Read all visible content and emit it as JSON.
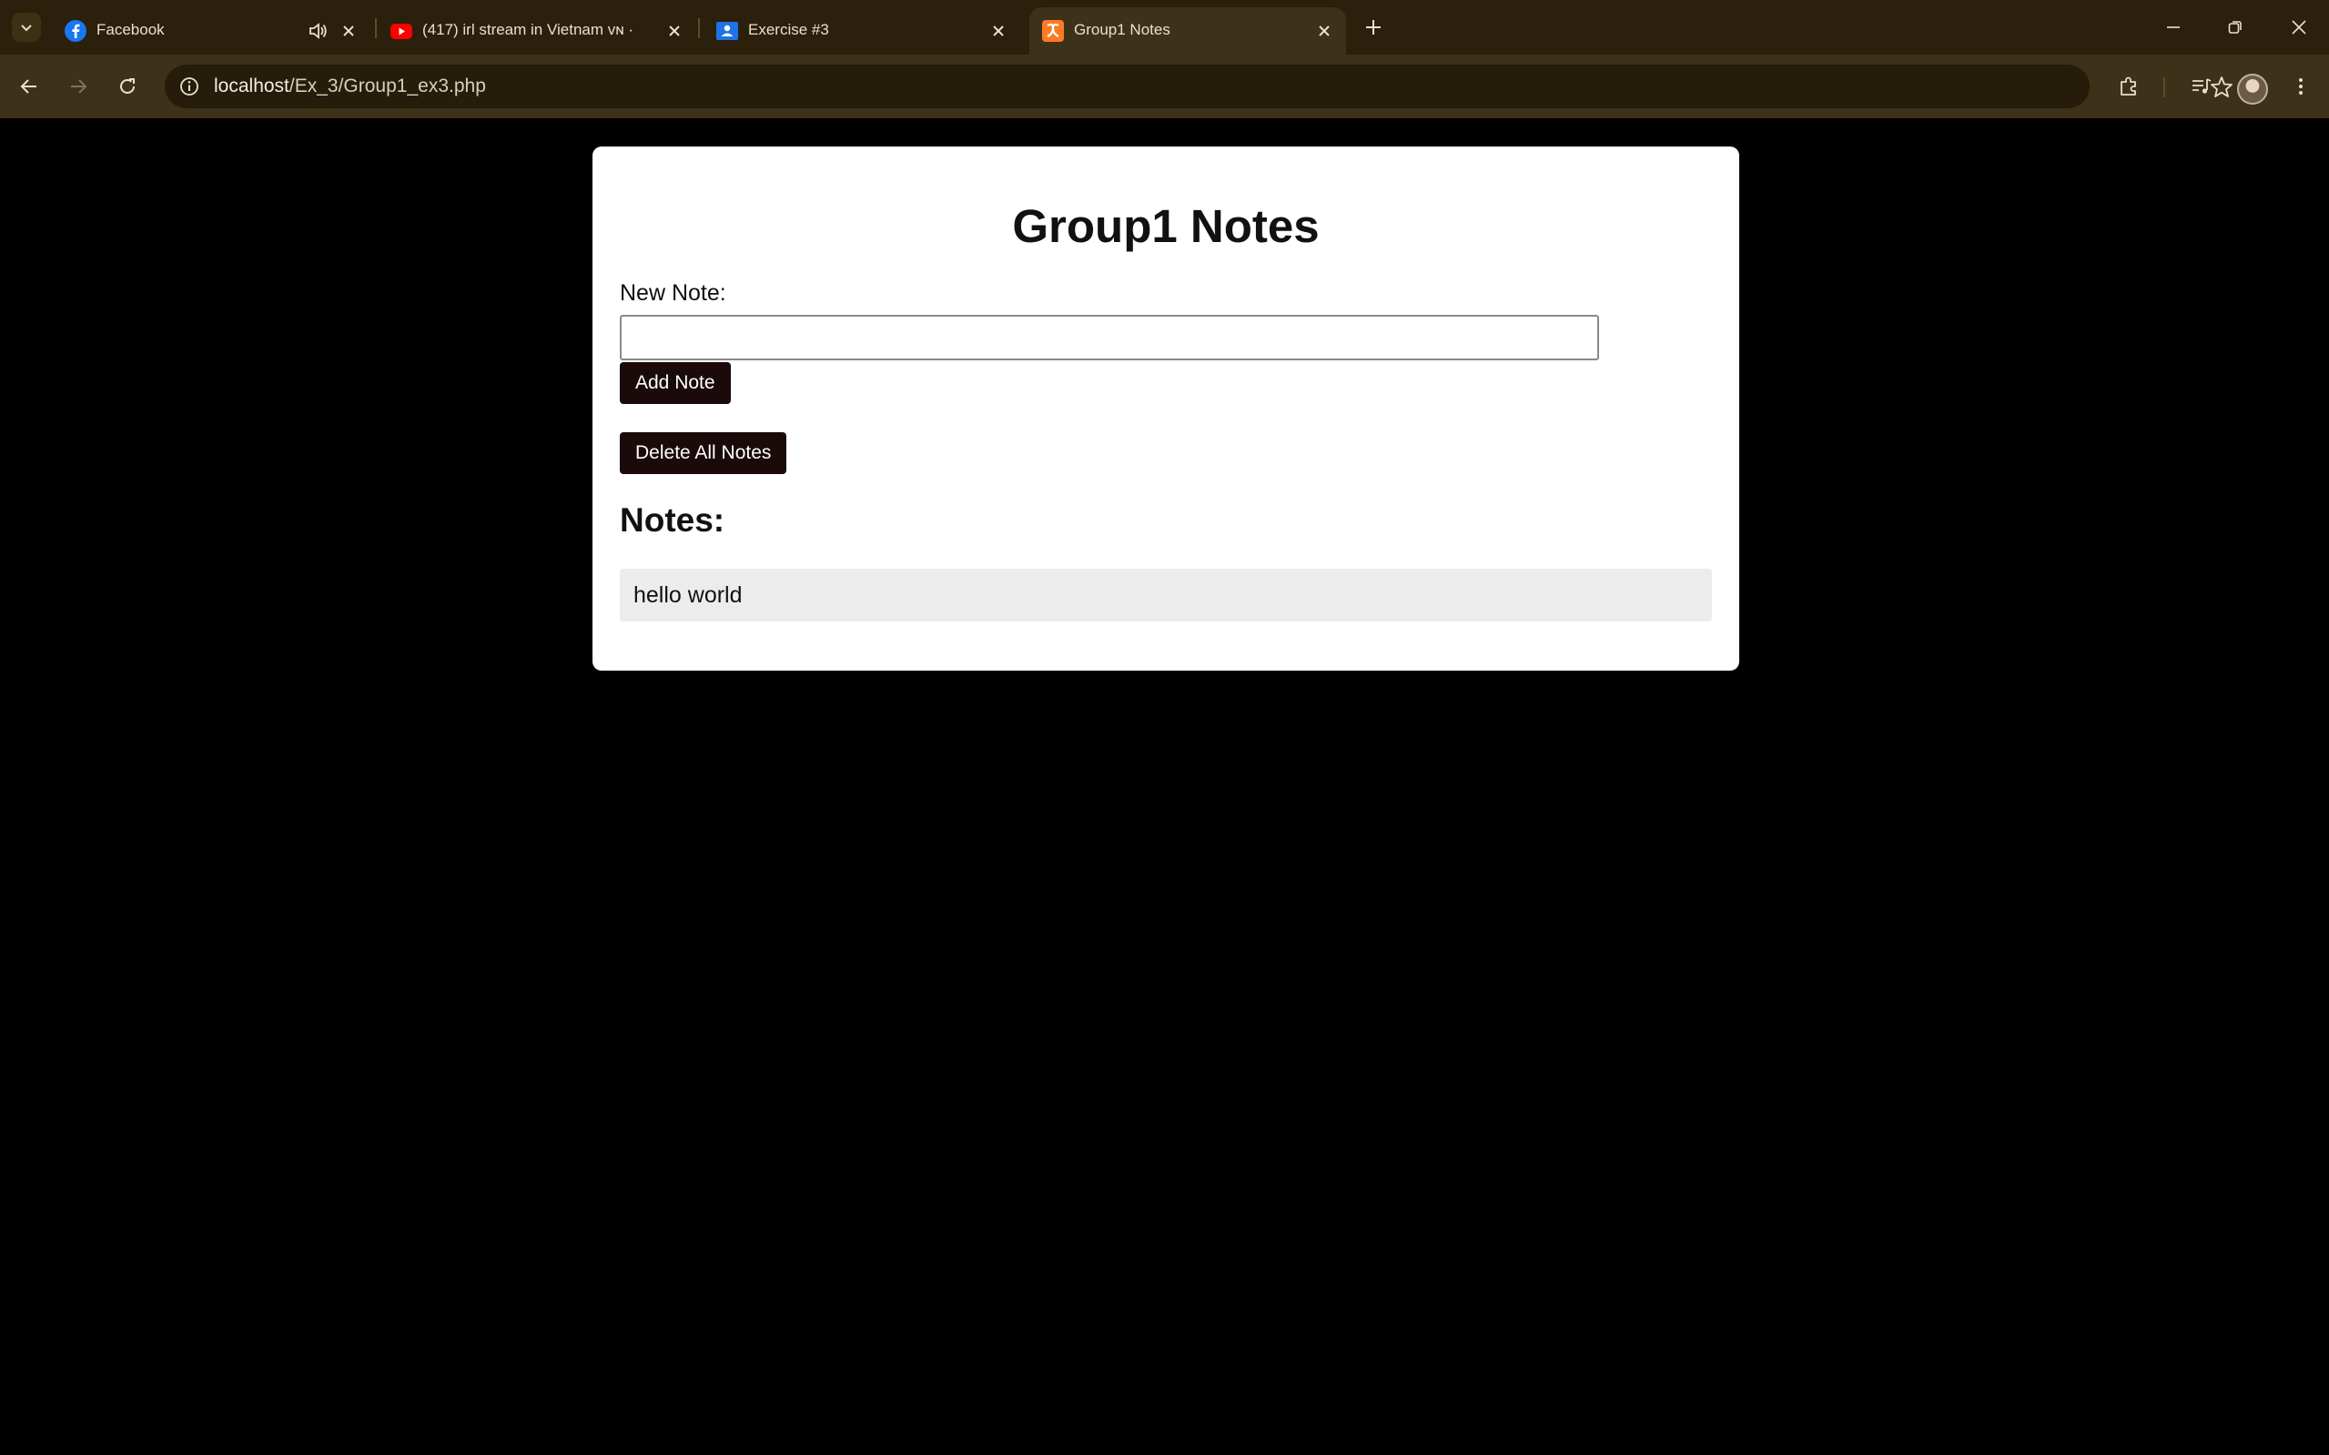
{
  "browser": {
    "tabs": [
      {
        "label": "Facebook",
        "icon": "facebook-icon"
      },
      {
        "label": "(417) irl stream in Vietnam ᴠɴ ·",
        "icon": "youtube-icon"
      },
      {
        "label": "Exercise #3",
        "icon": "google-classroom-icon"
      },
      {
        "label": "Group1 Notes",
        "icon": "xampp-icon",
        "active": true
      }
    ],
    "url_host": "localhost",
    "url_path": "/Ex_3/Group1_ex3.php"
  },
  "colors": {
    "tabstrip": "#2b200b",
    "toolbar": "#3e3119",
    "page_background": "#000000",
    "card": "#ffffff",
    "button": "#1a0a0a",
    "note_background": "#ececec"
  },
  "page": {
    "title": "Group1 Notes",
    "new_note_label": "New Note:",
    "new_note_value": "",
    "add_button": "Add Note",
    "delete_button": "Delete All Notes",
    "notes_heading": "Notes:",
    "notes": [
      {
        "text": "hello world"
      }
    ]
  }
}
